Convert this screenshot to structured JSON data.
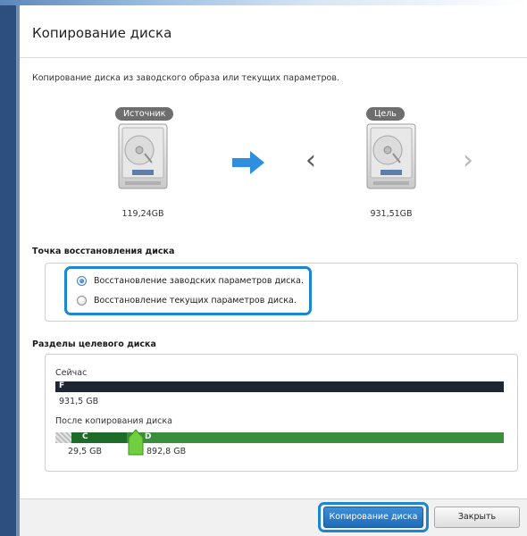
{
  "window": {
    "title": "Копирование диска",
    "description": "Копирование диска из заводского образа или текущих параметров."
  },
  "source": {
    "label": "Источник",
    "capacity": "119,24GB"
  },
  "target": {
    "label": "Цель",
    "capacity": "931,51GB"
  },
  "restore_point": {
    "heading": "Точка восстановления диска",
    "options": [
      {
        "label": "Восстановление заводских параметров диска.",
        "selected": true
      },
      {
        "label": "Восстановление текущих параметров диска.",
        "selected": false
      }
    ]
  },
  "partitions": {
    "heading": "Разделы целевого диска",
    "now_label": "Сейчас",
    "now_bar": {
      "letter": "F",
      "size": "931,5 GB",
      "color": "#1e2533"
    },
    "after_label": "После копирования диска",
    "after_bar": [
      {
        "letter": "C",
        "size": "29,5 GB",
        "color": "#1f6b2a"
      },
      {
        "letter": "D",
        "size": "892,8 GB",
        "color": "#3b8f3c"
      }
    ]
  },
  "buttons": {
    "copy": "Копирование диска",
    "close": "Закрыть"
  },
  "colors": {
    "accent": "#1c86d1",
    "arrow": "#2e8fde",
    "handle": "#6fcf3e"
  }
}
